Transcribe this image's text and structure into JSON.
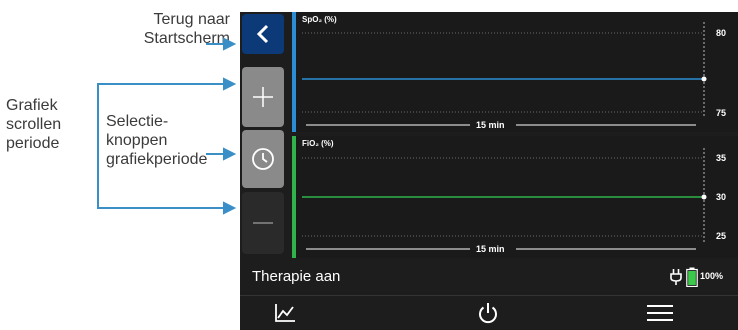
{
  "callouts": {
    "back": [
      "Terug naar",
      "Startscherm"
    ],
    "scroll": [
      "Grafiek",
      "scrollen",
      "periode"
    ],
    "select": [
      "Selectie-",
      "knoppen",
      "grafiekperiode"
    ]
  },
  "sidebar": {
    "back_icon": "chevron-left-icon",
    "zoom_in_icon": "plus-icon",
    "period_icon": "clock-icon",
    "zoom_out_icon": "minus-icon"
  },
  "panels": {
    "spo2": {
      "label": "SpO₂ (%)",
      "ticks": [
        "80",
        "75"
      ],
      "period": "15 min",
      "color": "#2b8ed4"
    },
    "fio2": {
      "label": "FiO₂ (%)",
      "ticks": [
        "35",
        "30",
        "25"
      ],
      "period": "15 min",
      "color": "#2fb34a"
    }
  },
  "status": {
    "therapy": "Therapie aan",
    "battery": "100%",
    "battery_color": "#3cc84a",
    "power_icon": "plug-icon"
  },
  "nav": {
    "graph_icon": "graph-icon",
    "power_icon": "power-icon",
    "menu_icon": "menu-icon"
  }
}
